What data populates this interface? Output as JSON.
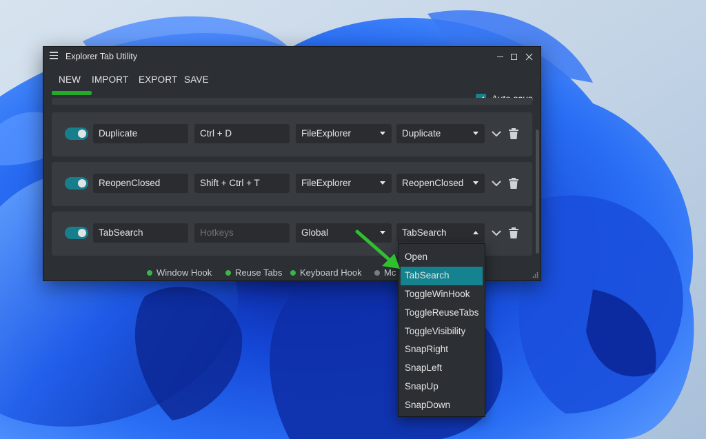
{
  "window": {
    "title": "Explorer Tab Utility",
    "menu": [
      "NEW",
      "IMPORT",
      "EXPORT",
      "SAVE"
    ],
    "autosave_label": "Auto save",
    "autosave_checked": true
  },
  "hotkeys": [
    {
      "enabled": true,
      "name": "Duplicate",
      "hotkeys": "Ctrl + D",
      "hotkeys_placeholder": "",
      "scope": "FileExplorer",
      "action": "Duplicate"
    },
    {
      "enabled": true,
      "name": "ReopenClosed",
      "hotkeys": "Shift + Ctrl + T",
      "hotkeys_placeholder": "",
      "scope": "FileExplorer",
      "action": "ReopenClosed"
    },
    {
      "enabled": true,
      "name": "TabSearch",
      "hotkeys": "",
      "hotkeys_placeholder": "Hotkeys",
      "scope": "Global",
      "action": "TabSearch"
    }
  ],
  "status": [
    {
      "label": "Window Hook",
      "color": "#3bb54a"
    },
    {
      "label": "Reuse Tabs",
      "color": "#3bb54a"
    },
    {
      "label": "Keyboard Hook",
      "color": "#3bb54a"
    },
    {
      "label": "Mc",
      "color": "#7a7d81"
    }
  ],
  "action_dropdown": {
    "options": [
      "Open",
      "TabSearch",
      "ToggleWinHook",
      "ToggleReuseTabs",
      "ToggleVisibility",
      "SnapRight",
      "SnapLeft",
      "SnapUp",
      "SnapDown"
    ],
    "selected": "TabSearch"
  },
  "colors": {
    "accent_teal": "#14838f",
    "active_tab_underline": "#25a92b",
    "annotation_arrow": "#2fbf2f",
    "status_on": "#3bb54a",
    "status_off": "#7a7d81"
  },
  "icons": [
    "hamburger-icon",
    "minimize-icon",
    "maximize-icon",
    "close-icon",
    "check-icon",
    "chevron-down-icon",
    "trash-icon",
    "caret-down-icon",
    "caret-up-icon",
    "resize-grip-icon",
    "annotation-arrow"
  ]
}
